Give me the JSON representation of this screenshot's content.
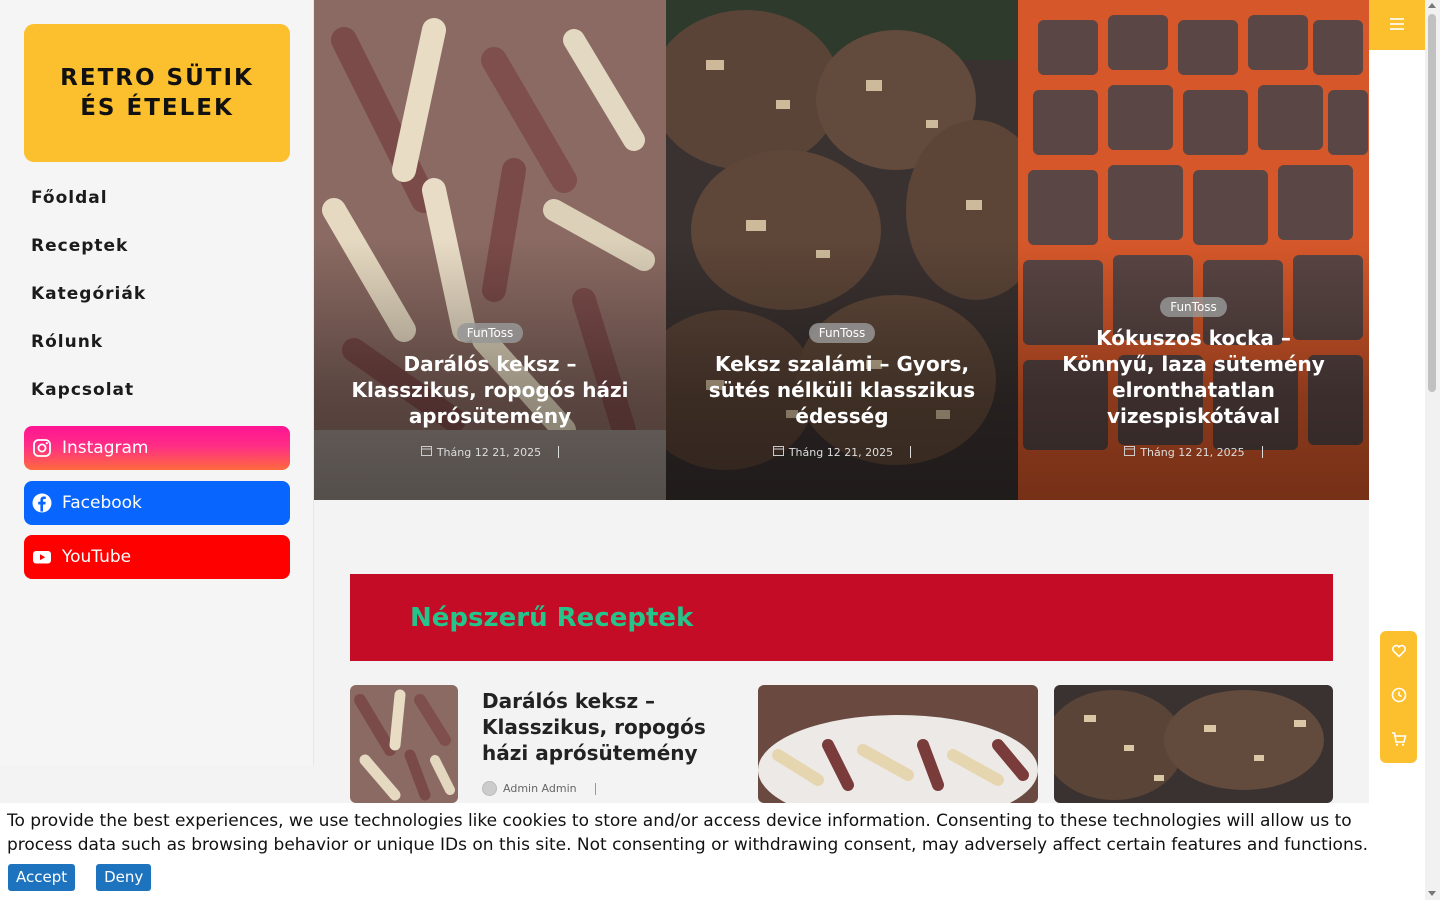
{
  "site": {
    "logo_text": "RETRO SÜTIK ÉS ÉTELEK"
  },
  "nav": {
    "items": [
      {
        "label": "Főoldal"
      },
      {
        "label": "Receptek"
      },
      {
        "label": "Kategóriák"
      },
      {
        "label": "Rólunk"
      },
      {
        "label": "Kapcsolat"
      }
    ]
  },
  "social": {
    "instagram": {
      "label": "Instagram",
      "icon": "instagram-icon",
      "color": "#ff1493"
    },
    "facebook": {
      "label": "Facebook",
      "icon": "facebook-icon",
      "color": "#0866ff"
    },
    "youtube": {
      "label": "YouTube",
      "icon": "youtube-icon",
      "color": "#ff0000"
    }
  },
  "hero": {
    "cards": [
      {
        "badge": "FunToss",
        "title": "Darálós keksz – Klasszikus, ropogós házi aprósütemény",
        "date": "Tháng 12 21, 2025"
      },
      {
        "badge": "FunToss",
        "title": "Keksz szalámi – Gyors, sütés nélküli klasszikus édesség",
        "date": "Tháng 12 21, 2025"
      },
      {
        "badge": "FunToss",
        "title": "Kókuszos kocka – Könnyű, laza sütemény elronthatatlan vizespiskótával",
        "date": "Tháng 12 21, 2025"
      }
    ]
  },
  "popular": {
    "heading": "Népszerű Receptek",
    "post": {
      "title": "Darálós keksz – Klasszikus, ropogós házi aprósütemény",
      "author": "Admin Admin"
    }
  },
  "cookie": {
    "text": "To provide the best experiences, we use technologies like cookies to store and/or access device information. Consenting to these technologies will allow us to process data such as browsing behavior or unique IDs on this site. Not consenting or withdrawing consent, may adversely affect certain features and functions.",
    "accept": "Accept",
    "deny": "Deny"
  },
  "colors": {
    "accent": "#fcc02e",
    "banner": "#c40c27",
    "banner_text": "#25c48a",
    "cookie_button": "#1e73be"
  },
  "icons": {
    "menu": "hamburger-icon",
    "float": [
      "heart-icon",
      "clock-icon",
      "cart-icon"
    ]
  }
}
